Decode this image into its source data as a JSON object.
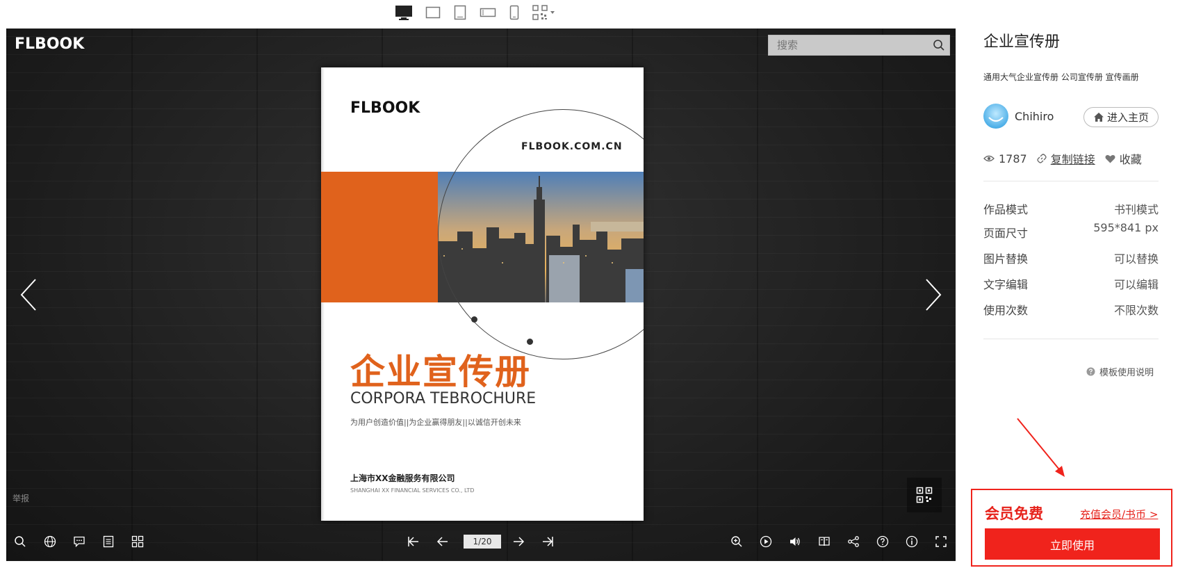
{
  "viewer": {
    "logo_text": "FLBOOK",
    "search_placeholder": "搜索",
    "report_label": "举报",
    "page_counter": "1/20"
  },
  "page": {
    "logo_text": "FLBOOK",
    "url": "FLBOOK.COM.CN",
    "title_cn": "企业宣传册",
    "title_en": "CORPORA TEBROCHURE",
    "slogan": "为用户创造价值||为企业赢得朋友||以诚信开创未来",
    "company_cn": "上海市XX金融服务有限公司",
    "company_en": "SHANGHAI XX FINANCIAL SERVICES CO., LTD",
    "accent_color": "#e0621c"
  },
  "sidebar": {
    "title": "企业宣传册",
    "tags": "通用大气企业宣传册 公司宣传册 宣传画册",
    "author_name": "Chihiro",
    "home_label": "进入主页",
    "views": "1787",
    "copy_link_label": "复制链接",
    "favorite_label": "收藏",
    "attributes": [
      {
        "label": "作品模式",
        "value": "书刊模式"
      },
      {
        "label": "页面尺寸",
        "value": "595*841 px"
      },
      {
        "label": "图片替换",
        "value": "可以替换"
      },
      {
        "label": "文字编辑",
        "value": "可以编辑"
      },
      {
        "label": "使用次数",
        "value": "不限次数"
      }
    ],
    "template_help_label": "模板使用说明"
  },
  "cta": {
    "member_free": "会员免费",
    "recharge_link": "充值会员/书币 >",
    "use_now": "立即使用",
    "brand_red": "#f0231c"
  }
}
